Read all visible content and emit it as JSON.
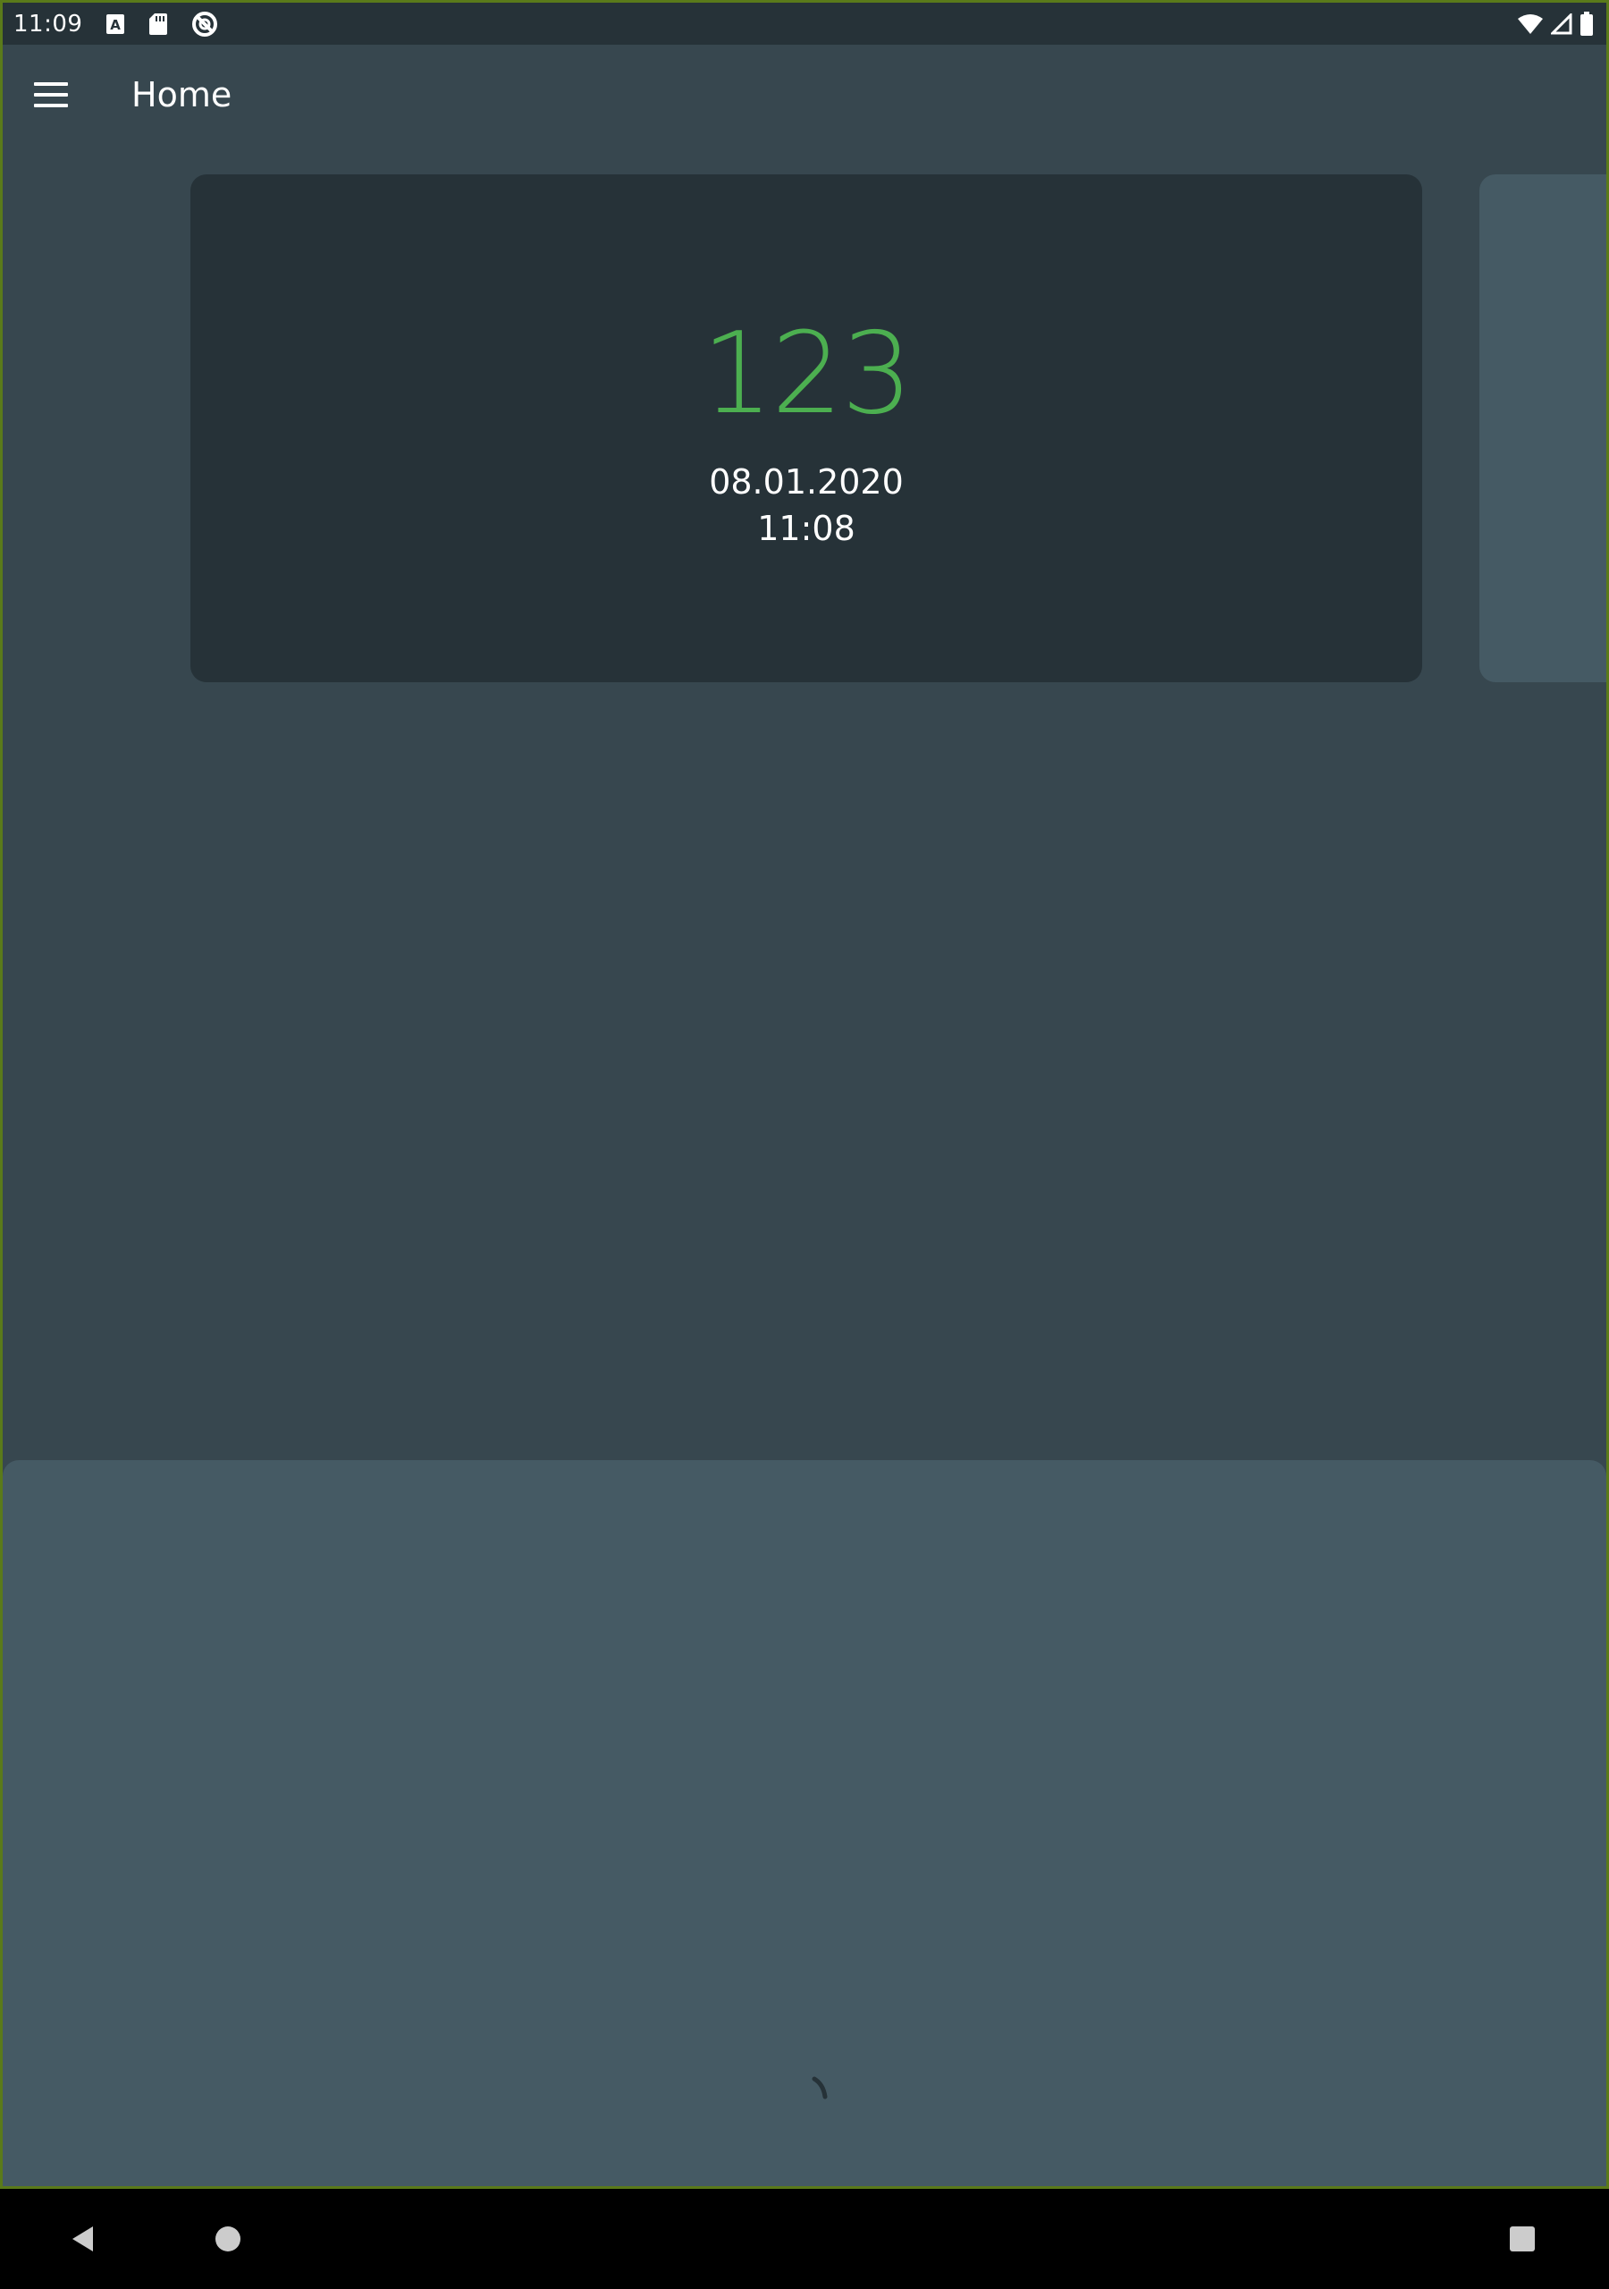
{
  "status_bar": {
    "time": "11:09",
    "left_icons": [
      "text-a-icon",
      "sd-card-icon",
      "no-disturb-icon"
    ],
    "right_icons": [
      "wifi-icon",
      "cell-signal-icon",
      "battery-icon"
    ]
  },
  "app_bar": {
    "menu_icon": "hamburger-menu-icon",
    "title": "Home"
  },
  "card": {
    "value": "123",
    "date": "08.01.2020",
    "time": "11:08",
    "value_color": "#4caf50"
  },
  "colors": {
    "background": "#37474f",
    "statusbar": "#263238",
    "card": "#263238",
    "sheet": "#455a64",
    "accent": "#4caf50"
  },
  "nav_bar": {
    "buttons": [
      "back-icon",
      "home-icon",
      "recents-icon"
    ]
  }
}
